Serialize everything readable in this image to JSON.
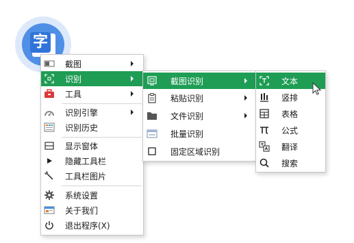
{
  "app_icon": {
    "glyph": "字",
    "icon": "translate-app-icon",
    "colors": {
      "outer": "#dde9fb",
      "inner": "#4f8fe6",
      "badge": "#2f74d8"
    }
  },
  "accent_color": "#1f9d55",
  "main_menu": {
    "items": [
      {
        "label": "截图",
        "icon": "screenshot-icon",
        "has_submenu": true
      },
      {
        "label": "识别",
        "icon": "scan-icon",
        "has_submenu": true,
        "active": true
      },
      {
        "label": "工具",
        "icon": "toolbox-icon",
        "has_submenu": true
      },
      {
        "label": "识别引擎",
        "icon": "engine-icon",
        "has_submenu": true
      },
      {
        "label": "识别历史",
        "icon": "history-icon"
      },
      {
        "label": "显示窗体",
        "icon": "window-icon"
      },
      {
        "label": "隐藏工具栏",
        "icon": "play-icon"
      },
      {
        "label": "工具栏图片",
        "icon": "magic-wand-icon"
      },
      {
        "label": "系统设置",
        "icon": "gear-icon"
      },
      {
        "label": "关于我们",
        "icon": "about-icon"
      },
      {
        "label": "退出程序(X)",
        "icon": "power-icon"
      }
    ]
  },
  "recognize_menu": {
    "items": [
      {
        "label": "截图识别",
        "icon": "screenshot-scan-icon",
        "has_submenu": true,
        "active": true
      },
      {
        "label": "粘贴识别",
        "icon": "clipboard-icon",
        "has_submenu": true
      },
      {
        "label": "文件识别",
        "icon": "folder-icon",
        "has_submenu": true
      },
      {
        "label": "批量识别",
        "icon": "batch-icon"
      },
      {
        "label": "固定区域识别",
        "icon": "square-icon"
      }
    ]
  },
  "screenshot_menu": {
    "items": [
      {
        "label": "文本",
        "icon": "text-scan-icon",
        "active": true
      },
      {
        "label": "竖排",
        "icon": "vertical-text-icon"
      },
      {
        "label": "表格",
        "icon": "table-icon"
      },
      {
        "label": "公式",
        "icon": "pi-icon"
      },
      {
        "label": "翻译",
        "icon": "translate-icon"
      },
      {
        "label": "搜索",
        "icon": "search-icon"
      }
    ]
  }
}
